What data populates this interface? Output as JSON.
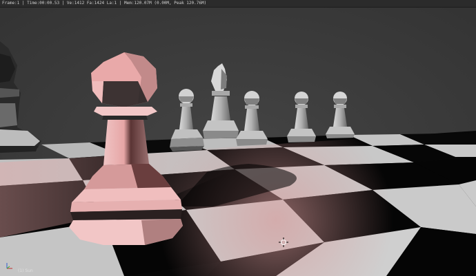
{
  "render_info": "Frame:1 | Time:00:00.53 | Ve:1412 Fa:1424 La:1 | Mem:120.07M (0.00M, Peak 120.76M)",
  "viewport_label": "(1) Sun",
  "icons": {
    "axis_gizmo": "axis-gizmo-icon",
    "cursor": "3d-cursor-icon"
  },
  "colors": {
    "background": "#3a3a3a",
    "tile_light": "#c8c8c8",
    "tile_dark": "#050505",
    "tint": "#e8a8a8"
  }
}
